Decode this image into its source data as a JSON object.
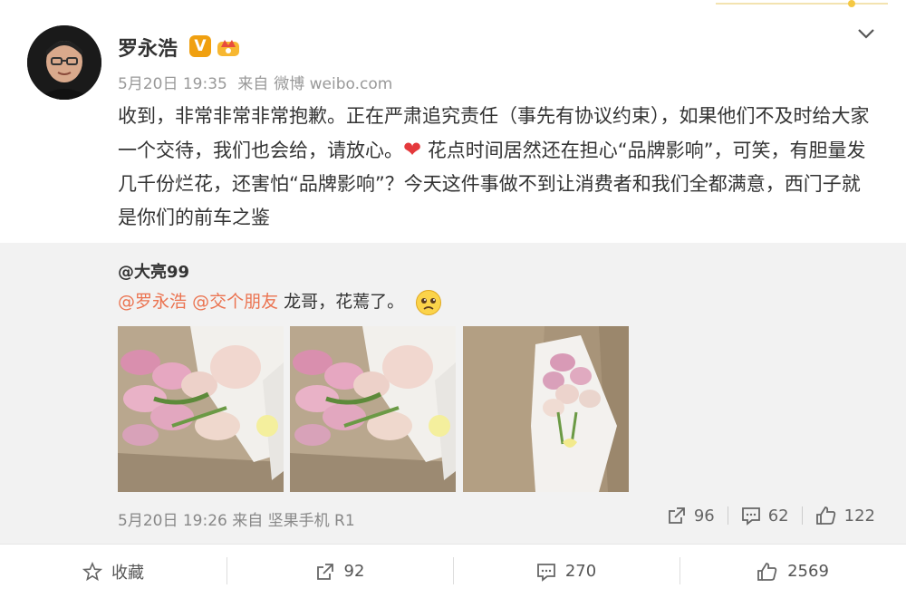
{
  "post": {
    "user_name": "罗永浩",
    "verified_label": "V",
    "date": "5月20日 19:35",
    "source_prefix": "来自",
    "source": "微博 weibo.com",
    "text_part1": "收到，非常非常非常抱歉。正在严肃追究责任（事先有协议约束），如果他们不及时给大家一个交待，我们也会给，请放心。",
    "heart": "❤",
    "text_part2": "花点时间居然还在担心“品牌影响”，可笑，有胆量发几千份烂花，还害怕“品牌影响”？今天这件事做不到让消费者和我们全都满意，西门子就是你们的前车之鉴"
  },
  "repost": {
    "user": "@大亮99",
    "mention1": "@罗永浩",
    "mention2": "@交个朋友",
    "text": "龙哥，花蔫了。",
    "date": "5月20日 19:26",
    "source_prefix": "来自",
    "source": "坚果手机 R1",
    "shares": "96",
    "comments": "62",
    "likes": "122"
  },
  "footer": {
    "favorite_label": "收藏",
    "shares": "92",
    "comments": "270",
    "likes": "2569"
  },
  "colors": {
    "mention": "#eb7350",
    "badge": "#f0a010",
    "repost_bg": "#f2f2f2"
  }
}
